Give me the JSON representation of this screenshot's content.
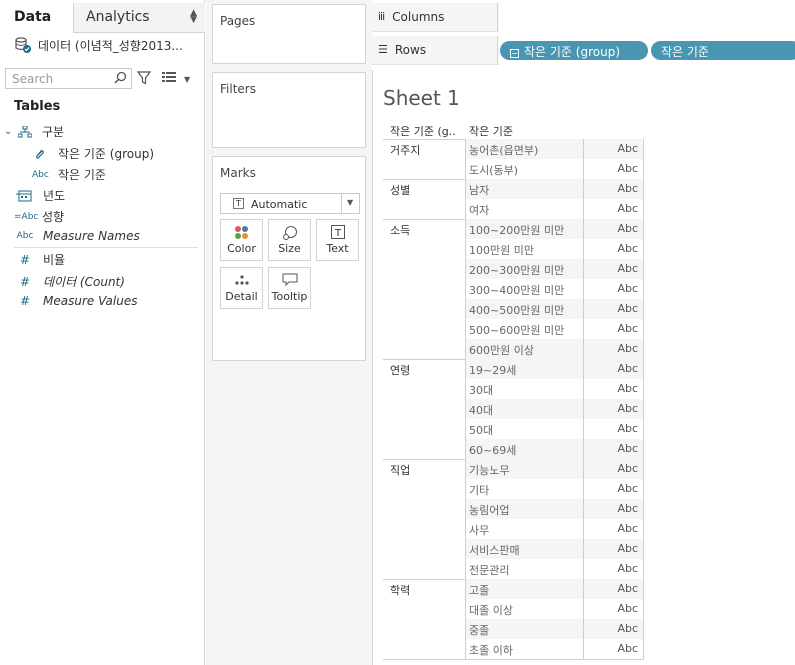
{
  "left": {
    "tabs": {
      "data": "Data",
      "analytics": "Analytics"
    },
    "datasource": "데이터 (이념적_성향2013...",
    "search_placeholder": "Search",
    "tables_heading": "Tables",
    "fields": [
      {
        "icon": "hierarchy",
        "label": "구분"
      },
      {
        "icon": "group",
        "label": "작은 기준 (group)"
      },
      {
        "icon": "Abc",
        "label": "작은 기준"
      },
      {
        "icon": "date",
        "label": "년도"
      },
      {
        "icon": "=Abc",
        "label": "성향"
      },
      {
        "icon": "Abc",
        "label": "Measure Names"
      },
      {
        "icon": "#",
        "label": "비율"
      },
      {
        "icon": "#",
        "label": "데이터 (Count)"
      },
      {
        "icon": "#",
        "label": "Measure Values"
      }
    ]
  },
  "middle": {
    "pages": "Pages",
    "filters": "Filters",
    "marks": "Marks",
    "mark_type": "Automatic",
    "buttons": {
      "color": "Color",
      "size": "Size",
      "text": "Text",
      "detail": "Detail",
      "tooltip": "Tooltip"
    }
  },
  "shelves": {
    "columns": "Columns",
    "rows": "Rows",
    "row_pills": [
      "작은 기준 (group)",
      "작은 기준"
    ]
  },
  "sheet": {
    "title": "Sheet 1",
    "headers": [
      "작은 기준 (g..",
      "작은 기준"
    ],
    "cell_value": "Abc",
    "groups": [
      {
        "name": "거주지",
        "items": [
          "농어촌(읍면부)",
          "도시(동부)"
        ]
      },
      {
        "name": "성별",
        "items": [
          "남자",
          "여자"
        ]
      },
      {
        "name": "소득",
        "items": [
          "100~200만원 미만",
          "100만원 미만",
          "200~300만원 미만",
          "300~400만원 미만",
          "400~500만원 미만",
          "500~600만원 미만",
          "600만원 이상"
        ]
      },
      {
        "name": "연령",
        "items": [
          "19~29세",
          "30대",
          "40대",
          "50대",
          "60~69세"
        ]
      },
      {
        "name": "직업",
        "items": [
          "기능노무",
          "기타",
          "농림어업",
          "사무",
          "서비스판매",
          "전문관리"
        ]
      },
      {
        "name": "학력",
        "items": [
          "고졸",
          "대졸 이상",
          "중졸",
          "초졸 이하"
        ]
      }
    ]
  }
}
